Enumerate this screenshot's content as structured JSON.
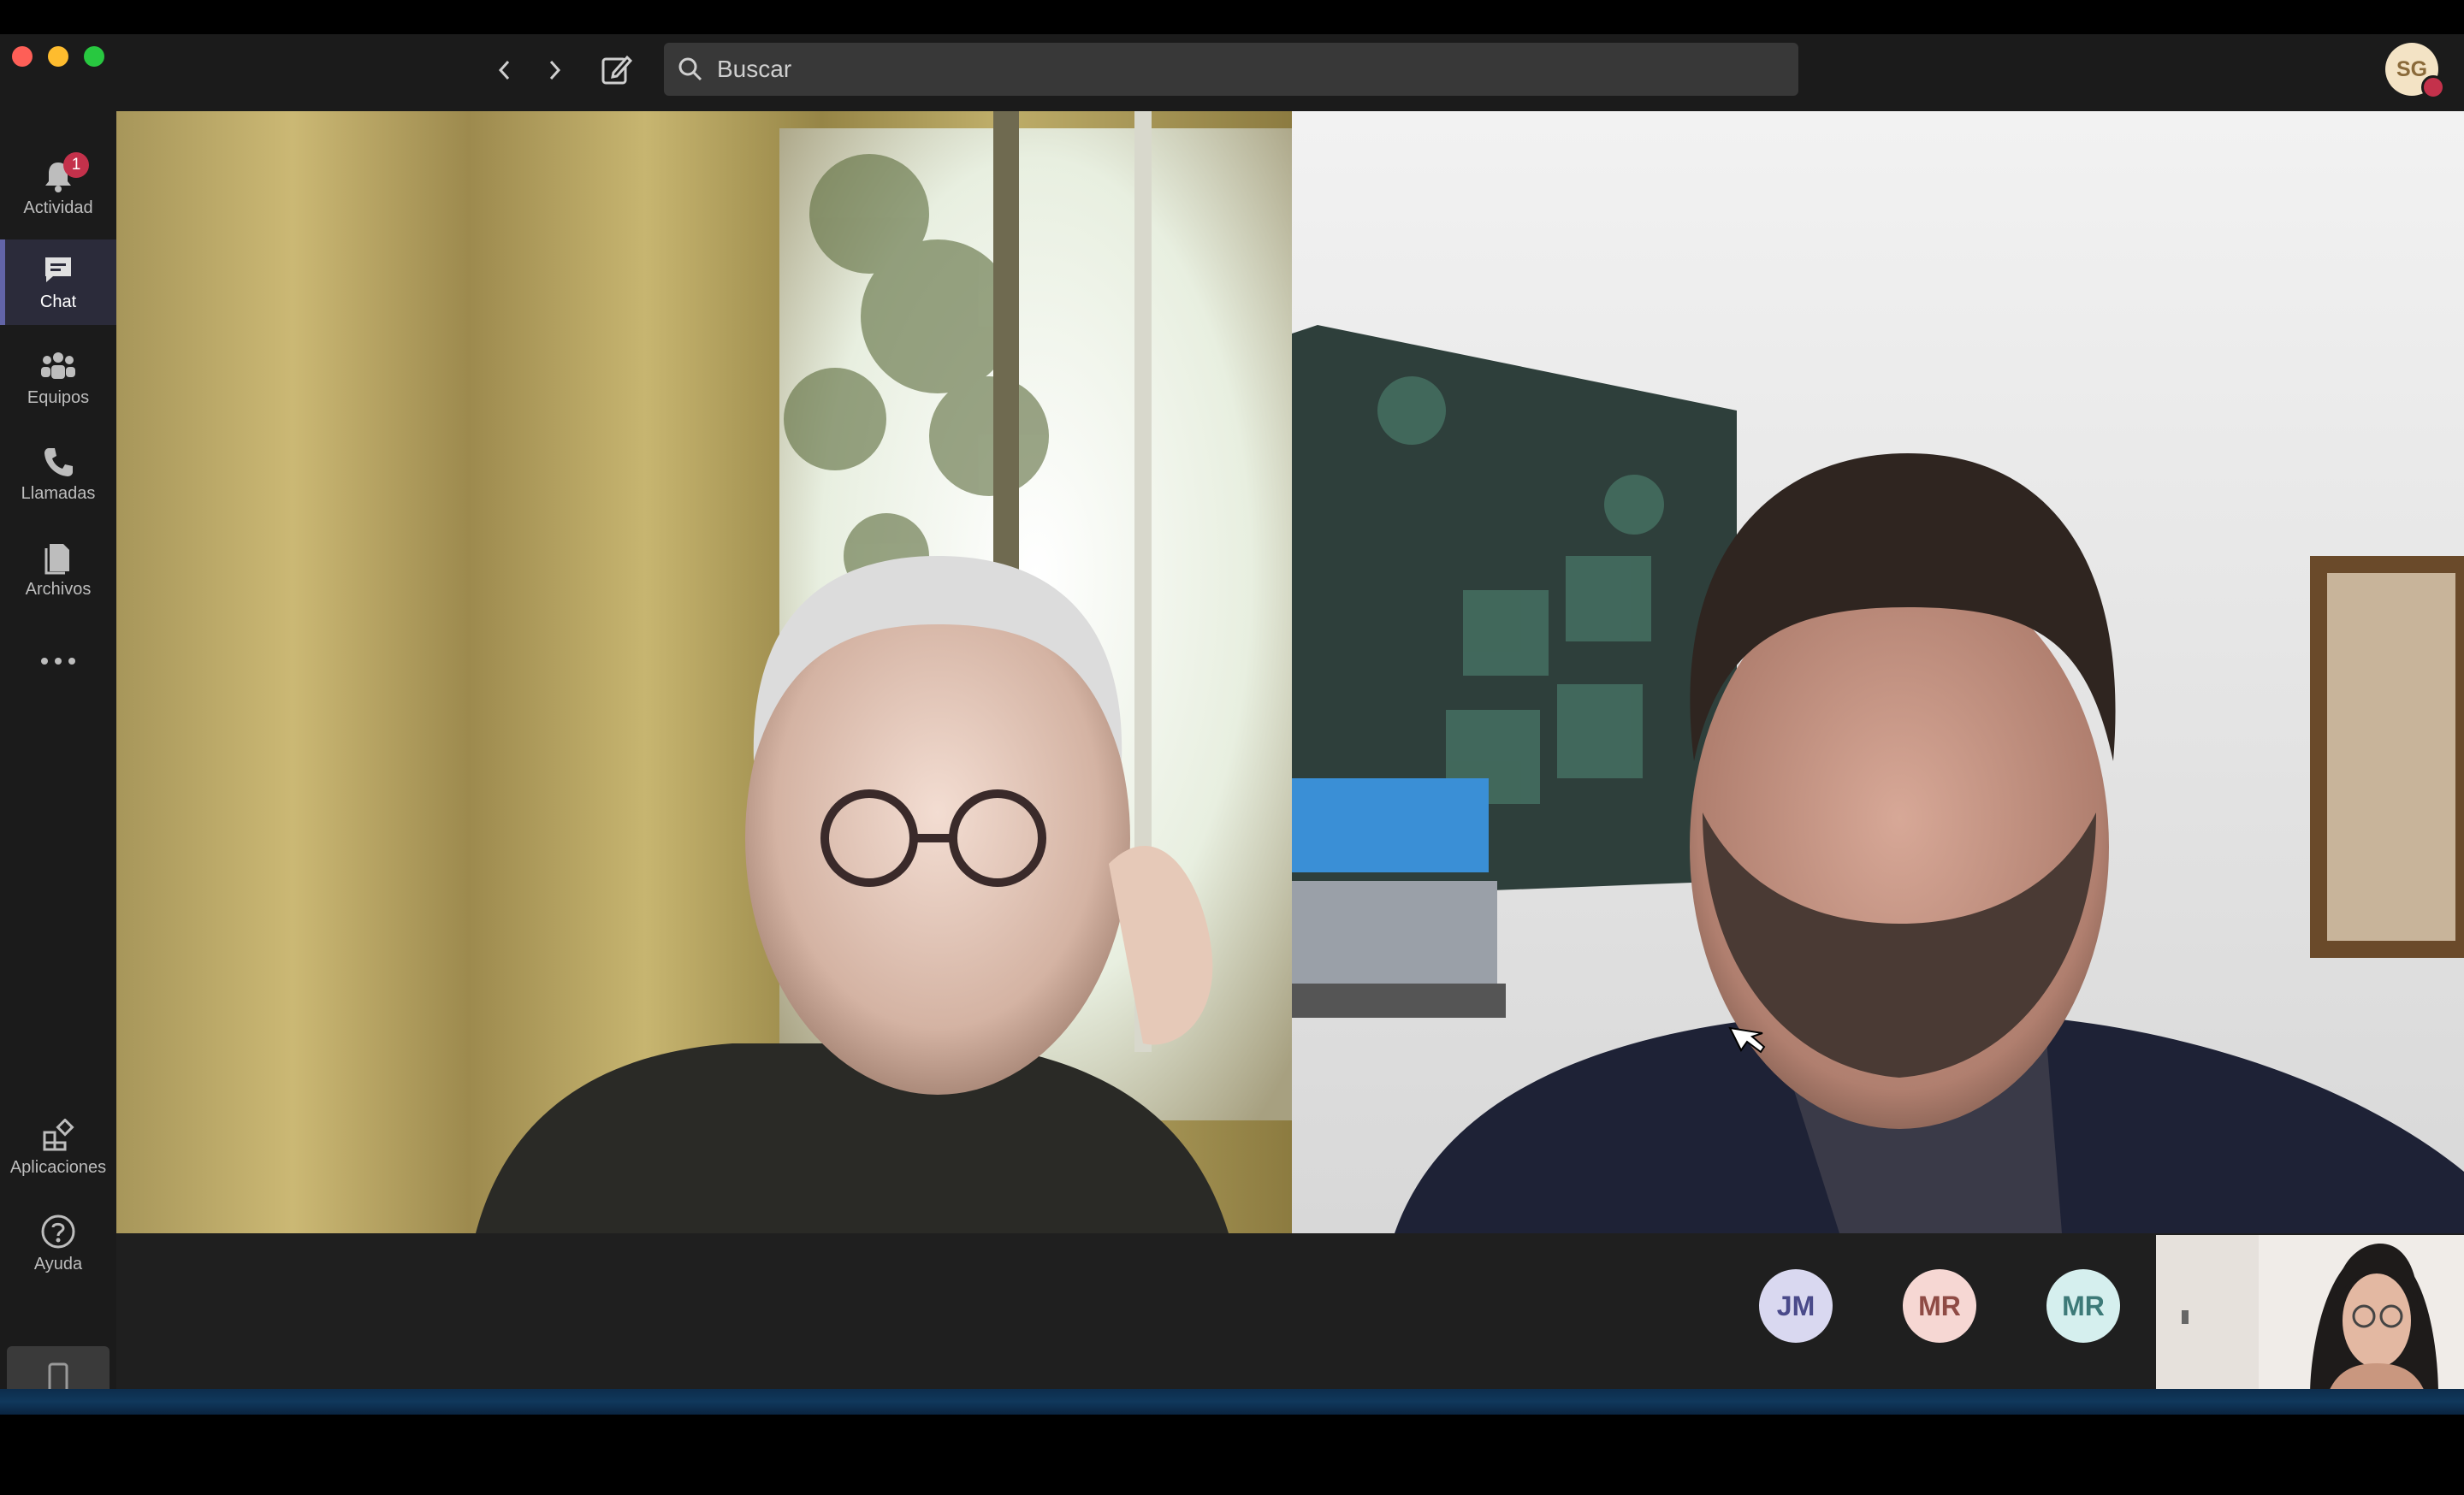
{
  "nav": {
    "back_label": "Atrás",
    "forward_label": "Adelante",
    "compose_label": "Nuevo chat"
  },
  "search": {
    "placeholder": "Buscar"
  },
  "user": {
    "initials": "SG",
    "status_color": "#c4314b"
  },
  "rail": {
    "items": [
      {
        "label": "Actividad",
        "icon": "bell-icon",
        "badge": "1"
      },
      {
        "label": "Chat",
        "icon": "chat-icon",
        "active": true
      },
      {
        "label": "Equipos",
        "icon": "teams-icon"
      },
      {
        "label": "Llamadas",
        "icon": "phone-icon"
      },
      {
        "label": "Archivos",
        "icon": "file-icon"
      }
    ],
    "more_icon": "ellipsis-icon",
    "bottom_items": [
      {
        "label": "Aplicaciones",
        "icon": "apps-icon"
      },
      {
        "label": "Ayuda",
        "icon": "help-icon"
      }
    ],
    "device_icon": "mobile-device-icon"
  },
  "call": {
    "participants": [
      {
        "initials": "JM",
        "bg": "#d9d8f0",
        "fg": "#4a4a8a"
      },
      {
        "initials": "MR",
        "bg": "#f6d7d3",
        "fg": "#8f4b45"
      },
      {
        "initials": "MR",
        "bg": "#d5efee",
        "fg": "#3d7a78"
      }
    ]
  },
  "colors": {
    "accent": "#6264a7",
    "badge": "#c4314b"
  }
}
